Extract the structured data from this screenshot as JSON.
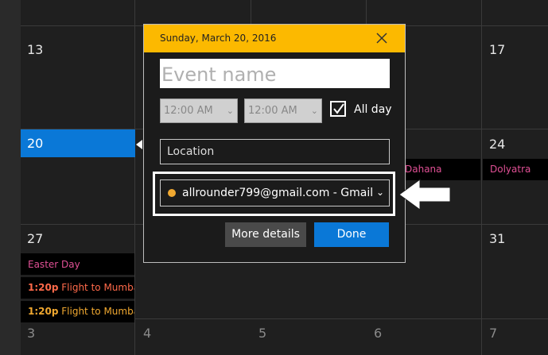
{
  "calendar": {
    "days": {
      "d13": "13",
      "d17": "17",
      "d20": "20",
      "d24": "24",
      "d27": "27",
      "d31": "31",
      "d3": "3",
      "d4": "4",
      "d5": "5",
      "d6": "6",
      "d7": "7"
    },
    "events": {
      "dahana": "Dahana",
      "dolyatra": "Dolyatra",
      "easter": "Easter Day",
      "flight1_time": "1:20p",
      "flight1_title": "Flight to Mumba",
      "flight2_time": "1:20p",
      "flight2_title": "Flight to Mumba"
    }
  },
  "dialog": {
    "date": "Sunday, March 20, 2016",
    "event_name_placeholder": "Event name",
    "start_time": "12:00 AM",
    "end_time": "12:00 AM",
    "all_day_label": "All day",
    "all_day_checked": true,
    "location_placeholder": "Location",
    "calendar_account": "allrounder799@gmail.com - Gmail",
    "calendar_color": "#f0a830",
    "more_details_label": "More details",
    "done_label": "Done"
  },
  "colors": {
    "header": "#fcb900",
    "accent": "#0a78d7"
  }
}
